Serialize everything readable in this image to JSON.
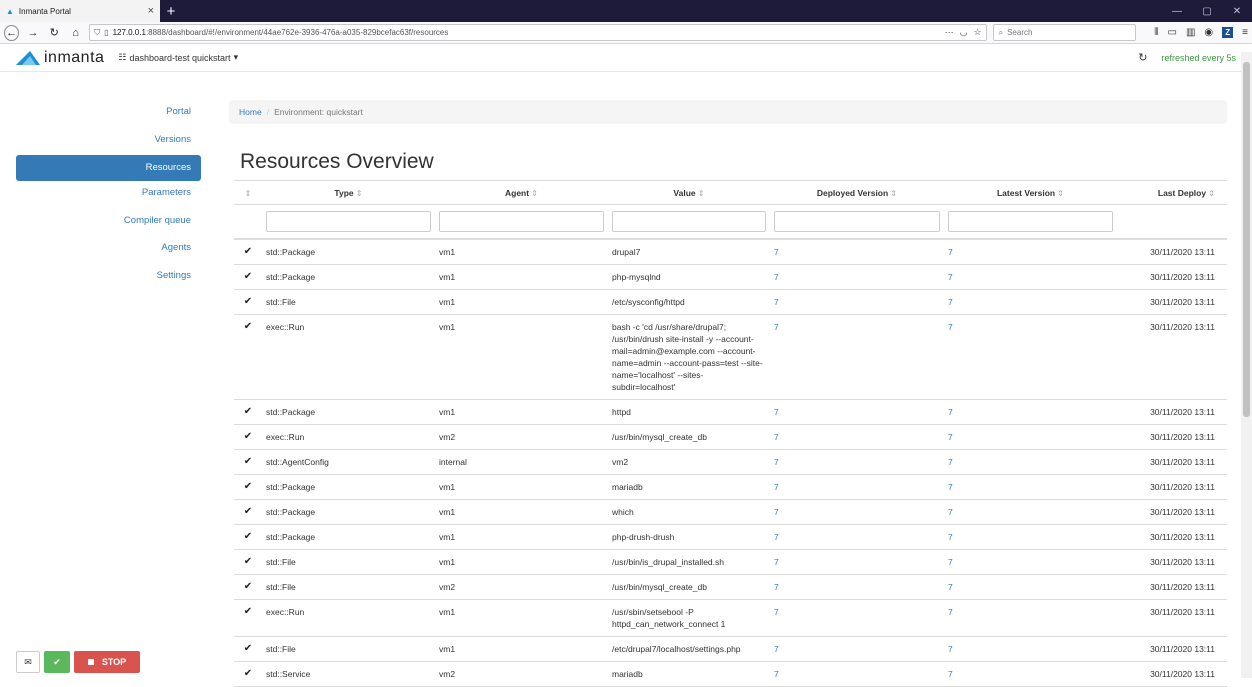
{
  "browser": {
    "tab_title": "Inmanta Portal",
    "url_base": "127.0.0.1",
    "url_rest": ":8888/dashboard/#!/environment/44ae762e-3936-476a-a035-829bcefac63f/resources",
    "search_placeholder": "Search"
  },
  "header": {
    "brand": "inmanta",
    "environment": "dashboard-test quickstart",
    "refresh_label": "refreshed every 5s"
  },
  "sidebar": {
    "items": [
      {
        "label": "Portal"
      },
      {
        "label": "Versions"
      },
      {
        "label": "Resources"
      },
      {
        "label": "Parameters"
      },
      {
        "label": "Compiler queue"
      },
      {
        "label": "Agents"
      },
      {
        "label": "Settings"
      }
    ],
    "active_index": 2
  },
  "controls": {
    "stop_label": "STOP"
  },
  "breadcrumb": {
    "home": "Home",
    "current": "Environment: quickstart"
  },
  "main": {
    "title": "Resources Overview"
  },
  "table": {
    "columns": [
      "Type",
      "Agent",
      "Value",
      "Deployed Version",
      "Latest Version",
      "Last Deploy"
    ],
    "rows": [
      {
        "type": "std::Package",
        "agent": "vm1",
        "value": "drupal7",
        "deployed": "7",
        "latest": "7",
        "last": "30/11/2020 13:11"
      },
      {
        "type": "std::Package",
        "agent": "vm1",
        "value": "php-mysqlnd",
        "deployed": "7",
        "latest": "7",
        "last": "30/11/2020 13:11"
      },
      {
        "type": "std::File",
        "agent": "vm1",
        "value": "/etc/sysconfig/httpd",
        "deployed": "7",
        "latest": "7",
        "last": "30/11/2020 13:11"
      },
      {
        "type": "exec::Run",
        "agent": "vm1",
        "value": "bash -c 'cd /usr/share/drupal7; /usr/bin/drush site-install -y --account-mail=admin@example.com --account-name=admin --account-pass=test --site-name='localhost' --sites-subdir=localhost'",
        "deployed": "7",
        "latest": "7",
        "last": "30/11/2020 13:11"
      },
      {
        "type": "std::Package",
        "agent": "vm1",
        "value": "httpd",
        "deployed": "7",
        "latest": "7",
        "last": "30/11/2020 13:11"
      },
      {
        "type": "exec::Run",
        "agent": "vm2",
        "value": "/usr/bin/mysql_create_db",
        "deployed": "7",
        "latest": "7",
        "last": "30/11/2020 13:11"
      },
      {
        "type": "std::AgentConfig",
        "agent": "internal",
        "value": "vm2",
        "deployed": "7",
        "latest": "7",
        "last": "30/11/2020 13:11"
      },
      {
        "type": "std::Package",
        "agent": "vm1",
        "value": "mariadb",
        "deployed": "7",
        "latest": "7",
        "last": "30/11/2020 13:11"
      },
      {
        "type": "std::Package",
        "agent": "vm1",
        "value": "which",
        "deployed": "7",
        "latest": "7",
        "last": "30/11/2020 13:11"
      },
      {
        "type": "std::Package",
        "agent": "vm1",
        "value": "php-drush-drush",
        "deployed": "7",
        "latest": "7",
        "last": "30/11/2020 13:11"
      },
      {
        "type": "std::File",
        "agent": "vm1",
        "value": "/usr/bin/is_drupal_installed.sh",
        "deployed": "7",
        "latest": "7",
        "last": "30/11/2020 13:11"
      },
      {
        "type": "std::File",
        "agent": "vm2",
        "value": "/usr/bin/mysql_create_db",
        "deployed": "7",
        "latest": "7",
        "last": "30/11/2020 13:11"
      },
      {
        "type": "exec::Run",
        "agent": "vm1",
        "value": "/usr/sbin/setsebool -P httpd_can_network_connect 1",
        "deployed": "7",
        "latest": "7",
        "last": "30/11/2020 13:11"
      },
      {
        "type": "std::File",
        "agent": "vm1",
        "value": "/etc/drupal7/localhost/settings.php",
        "deployed": "7",
        "latest": "7",
        "last": "30/11/2020 13:11"
      },
      {
        "type": "std::Service",
        "agent": "vm2",
        "value": "mariadb",
        "deployed": "7",
        "latest": "7",
        "last": "30/11/2020 13:11"
      }
    ]
  },
  "colors": {
    "accent": "#337ab7",
    "success": "#5cb85c",
    "danger": "#d9534f",
    "refresh": "#3c9b42"
  }
}
